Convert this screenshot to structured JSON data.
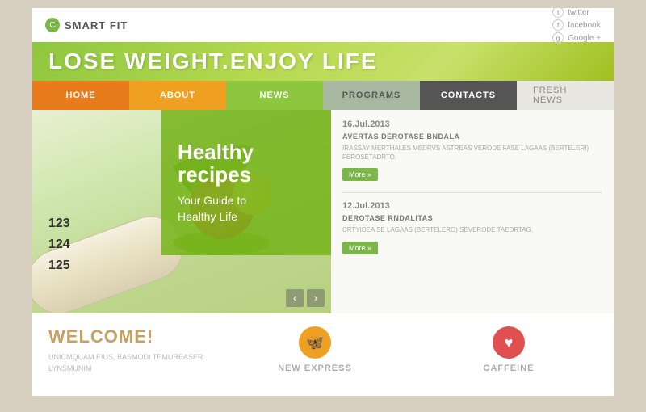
{
  "page": {
    "background": "#d6cfc0"
  },
  "logo": {
    "icon": "C",
    "text": "SMART FIT"
  },
  "social": {
    "links": [
      {
        "id": "twitter",
        "label": "twitter",
        "icon": "t"
      },
      {
        "id": "facebook",
        "label": "facebook",
        "icon": "f"
      },
      {
        "id": "google",
        "label": "Google +",
        "icon": "g"
      }
    ]
  },
  "hero": {
    "title_part1": "LOSE WEIGHT.",
    "title_part2": "ENJOY LIFE",
    "heading": "Healthy recipes",
    "subtext": "Your Guide to\nHealthy Life"
  },
  "nav": {
    "items": [
      {
        "id": "home",
        "label": "HOME",
        "class": "nav-home"
      },
      {
        "id": "about",
        "label": "ABOUT",
        "class": "nav-about"
      },
      {
        "id": "news",
        "label": "NEWS",
        "class": "nav-news"
      },
      {
        "id": "programs",
        "label": "PROGRAMS",
        "class": "nav-programs"
      },
      {
        "id": "contacts",
        "label": "CONTACTS",
        "class": "nav-contacts"
      },
      {
        "id": "fresh-news",
        "label": "FRESH NEWS",
        "class": "nav-fresh"
      }
    ]
  },
  "fresh_news": {
    "items": [
      {
        "date": "16.Jul.2013",
        "title": "AVERTAS DEROTASE BNDALA",
        "body": "IRASSAY MERTHALES MEDRVS ASTREAS\nVERODE FASE LAGAAS (BERTELERI)\nFEROSETADRTO.",
        "more_label": "More »"
      },
      {
        "date": "12.Jul.2013",
        "title": "DEROTASE RNDALITAS",
        "body": "CRTYIDEA SE LAGAAS (BERTELERO)\nSEVERODE TAEDRTAG.",
        "more_label": "More »"
      }
    ]
  },
  "tape_numbers": [
    "123",
    "124",
    "125"
  ],
  "bottom": {
    "welcome_title": "WELCOME!",
    "welcome_text": "UNICMQUAM EIUS, BASMODI TEMUREASER LYNSMUNIM",
    "col2": {
      "icon": "🦋",
      "label": "NEW EXPRESS"
    },
    "col3": {
      "icon": "♥",
      "label": "CAFFEINE"
    }
  },
  "arrows": {
    "left": "‹",
    "right": "›"
  }
}
